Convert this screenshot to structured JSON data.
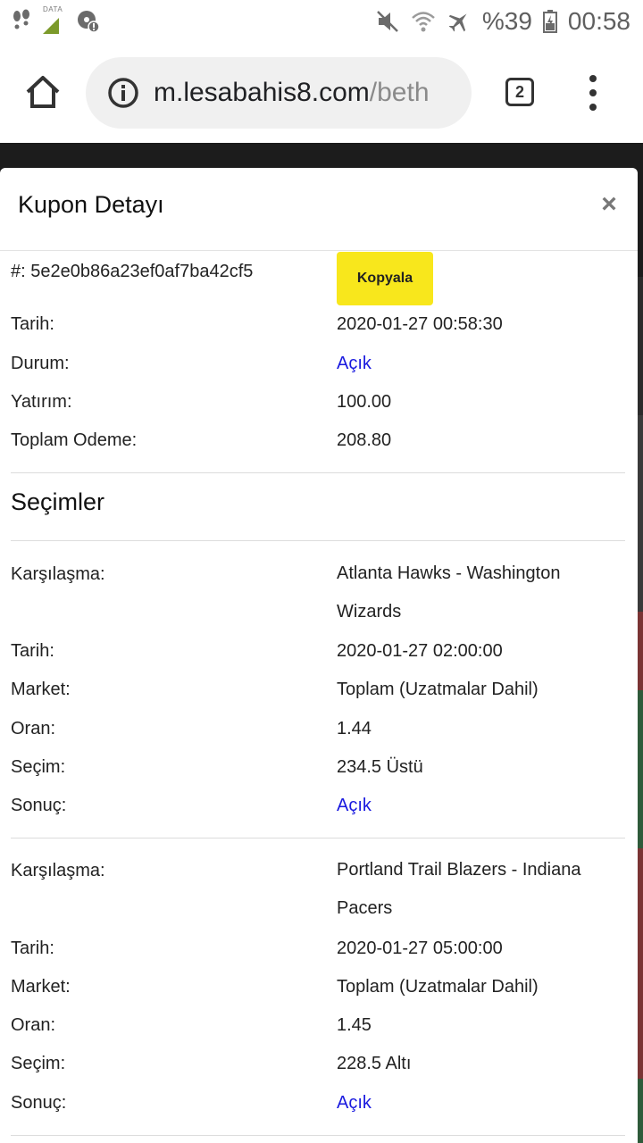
{
  "status_bar": {
    "data_tag": "DATA",
    "battery": "%39",
    "time": "00:58"
  },
  "browser": {
    "url_domain": "m.lesabahis8.com",
    "url_path": "/beth",
    "tab_count": "2"
  },
  "modal": {
    "title": "Kupon Detayı",
    "close": "×",
    "coupon": {
      "id_label": "#: 5e2e0b86a23ef0af7ba42cf5",
      "copy_label": "Kopyala",
      "rows": [
        {
          "label": "Tarih:",
          "value": "2020-01-27 00:58:30"
        },
        {
          "label": "Durum:",
          "value": "Açık"
        },
        {
          "label": "Yatırım:",
          "value": "100.00"
        },
        {
          "label": "Toplam Odeme:",
          "value": "208.80"
        }
      ]
    },
    "selections_title": "Seçimler",
    "selections": [
      {
        "rows": [
          {
            "label": "Karşılaşma:",
            "value": "Atlanta Hawks - Washington Wizards"
          },
          {
            "label": "Tarih:",
            "value": "2020-01-27 02:00:00"
          },
          {
            "label": "Market:",
            "value": "Toplam (Uzatmalar Dahil)"
          },
          {
            "label": "Oran:",
            "value": "1.44"
          },
          {
            "label": "Seçim:",
            "value": "234.5 Üstü"
          },
          {
            "label": "Sonuç:",
            "value": "Açık"
          }
        ]
      },
      {
        "rows": [
          {
            "label": "Karşılaşma:",
            "value": "Portland Trail Blazers - Indiana Pacers"
          },
          {
            "label": "Tarih:",
            "value": "2020-01-27 05:00:00"
          },
          {
            "label": "Market:",
            "value": "Toplam (Uzatmalar Dahil)"
          },
          {
            "label": "Oran:",
            "value": "1.45"
          },
          {
            "label": "Seçim:",
            "value": "228.5 Altı"
          },
          {
            "label": "Sonuç:",
            "value": "Açık"
          }
        ]
      }
    ]
  },
  "colors": {
    "link": "#1a1adf",
    "copy_button": "#f8e71c",
    "backdrop": "#1c1c1c"
  }
}
